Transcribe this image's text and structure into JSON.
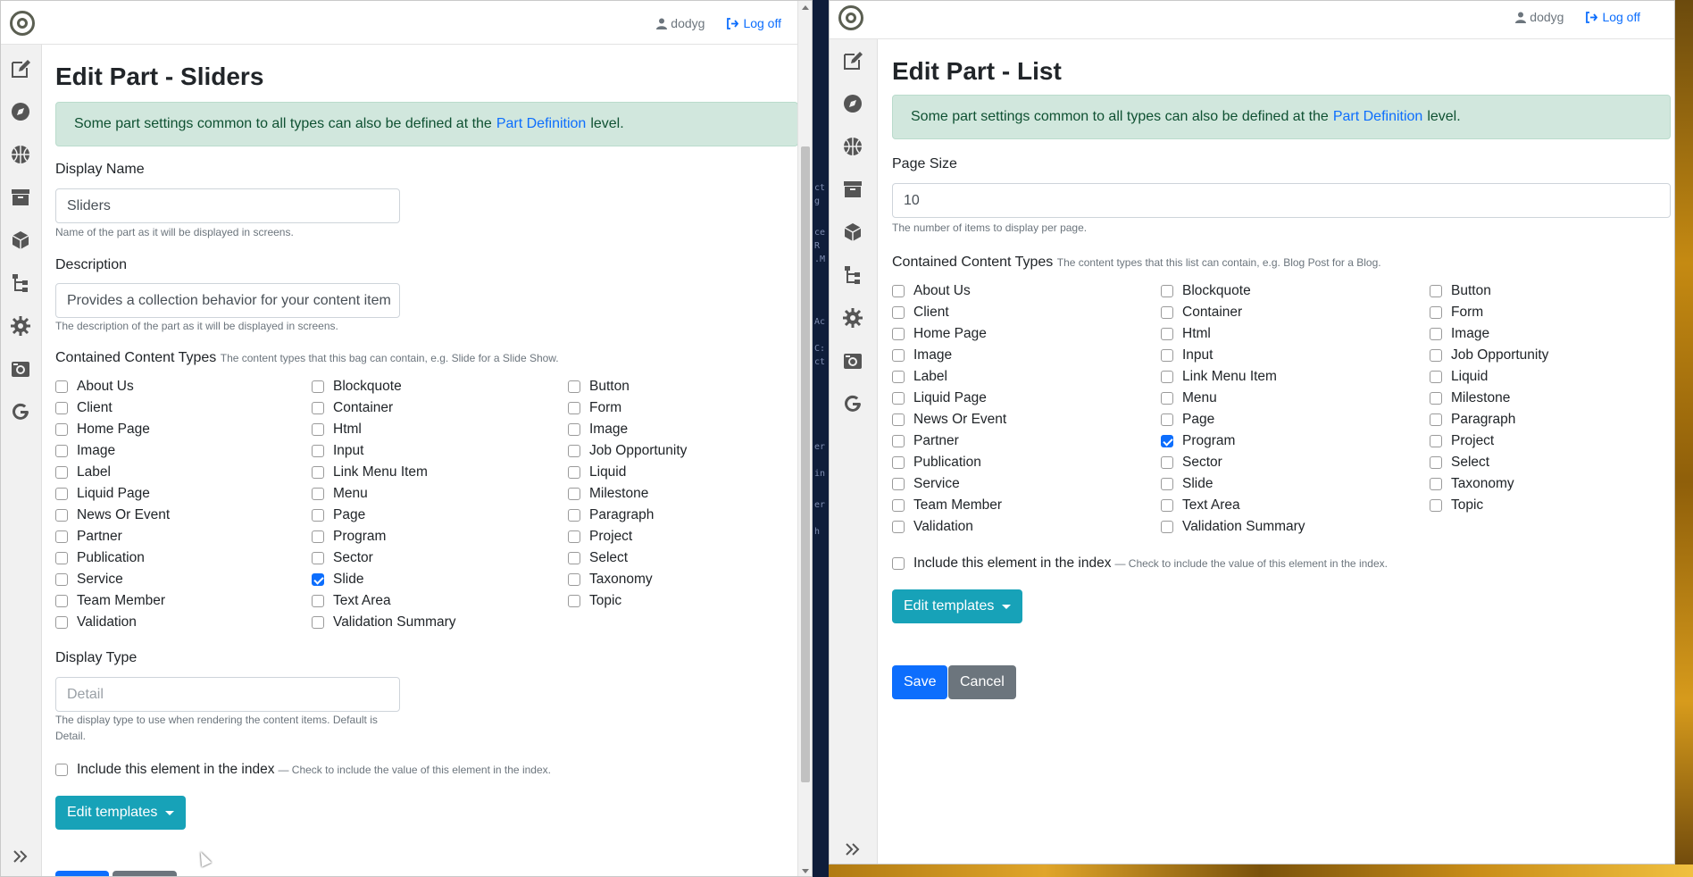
{
  "left_window": {
    "user": "dodyg",
    "logoff": "Log off",
    "title": "Edit Part - Sliders",
    "alert": {
      "prefix": "Some part settings common to all types can also be defined at the",
      "link": "Part Definition",
      "suffix": "level."
    },
    "display_name": {
      "label": "Display Name",
      "value": "Sliders",
      "hint": "Name of the part as it will be displayed in screens."
    },
    "description": {
      "label": "Description",
      "value": "Provides a collection behavior for your content item",
      "hint": "The description of the part as it will be displayed in screens."
    },
    "contained": {
      "label": "Contained Content Types",
      "hint": "The content types that this bag can contain, e.g. Slide for a Slide Show."
    },
    "col1": [
      {
        "label": "About Us",
        "checked": false
      },
      {
        "label": "Client",
        "checked": false
      },
      {
        "label": "Home Page",
        "checked": false
      },
      {
        "label": "Image",
        "checked": false
      },
      {
        "label": "Label",
        "checked": false
      },
      {
        "label": "Liquid Page",
        "checked": false
      },
      {
        "label": "News Or Event",
        "checked": false
      },
      {
        "label": "Partner",
        "checked": false
      },
      {
        "label": "Publication",
        "checked": false
      },
      {
        "label": "Service",
        "checked": false
      },
      {
        "label": "Team Member",
        "checked": false
      },
      {
        "label": "Validation",
        "checked": false
      }
    ],
    "col2": [
      {
        "label": "Blockquote",
        "checked": false
      },
      {
        "label": "Container",
        "checked": false
      },
      {
        "label": "Html",
        "checked": false
      },
      {
        "label": "Input",
        "checked": false
      },
      {
        "label": "Link Menu Item",
        "checked": false
      },
      {
        "label": "Menu",
        "checked": false
      },
      {
        "label": "Page",
        "checked": false
      },
      {
        "label": "Program",
        "checked": false
      },
      {
        "label": "Sector",
        "checked": false
      },
      {
        "label": "Slide",
        "checked": true
      },
      {
        "label": "Text Area",
        "checked": false
      },
      {
        "label": "Validation Summary",
        "checked": false
      }
    ],
    "col3": [
      {
        "label": "Button",
        "checked": false
      },
      {
        "label": "Form",
        "checked": false
      },
      {
        "label": "Image",
        "checked": false
      },
      {
        "label": "Job Opportunity",
        "checked": false
      },
      {
        "label": "Liquid",
        "checked": false
      },
      {
        "label": "Milestone",
        "checked": false
      },
      {
        "label": "Paragraph",
        "checked": false
      },
      {
        "label": "Project",
        "checked": false
      },
      {
        "label": "Select",
        "checked": false
      },
      {
        "label": "Taxonomy",
        "checked": false
      },
      {
        "label": "Topic",
        "checked": false
      }
    ],
    "display_type": {
      "label": "Display Type",
      "placeholder": "Detail",
      "hint": "The display type to use when rendering the content items. Default is Detail."
    },
    "index": {
      "label": "Include this element in the index",
      "hint": "— Check to include the value of this element in the index."
    },
    "edit_templates": "Edit templates"
  },
  "right_window": {
    "user": "dodyg",
    "logoff": "Log off",
    "title": "Edit Part - List",
    "alert": {
      "prefix": "Some part settings common to all types can also be defined at the",
      "link": "Part Definition",
      "suffix": "level."
    },
    "page_size": {
      "label": "Page Size",
      "value": "10",
      "hint": "The number of items to display per page."
    },
    "contained": {
      "label": "Contained Content Types",
      "hint": "The content types that this list can contain, e.g. Blog Post for a Blog."
    },
    "col1": [
      {
        "label": "About Us",
        "checked": false
      },
      {
        "label": "Client",
        "checked": false
      },
      {
        "label": "Home Page",
        "checked": false
      },
      {
        "label": "Image",
        "checked": false
      },
      {
        "label": "Label",
        "checked": false
      },
      {
        "label": "Liquid Page",
        "checked": false
      },
      {
        "label": "News Or Event",
        "checked": false
      },
      {
        "label": "Partner",
        "checked": false
      },
      {
        "label": "Publication",
        "checked": false
      },
      {
        "label": "Service",
        "checked": false
      },
      {
        "label": "Team Member",
        "checked": false
      },
      {
        "label": "Validation",
        "checked": false
      }
    ],
    "col2": [
      {
        "label": "Blockquote",
        "checked": false
      },
      {
        "label": "Container",
        "checked": false
      },
      {
        "label": "Html",
        "checked": false
      },
      {
        "label": "Input",
        "checked": false
      },
      {
        "label": "Link Menu Item",
        "checked": false
      },
      {
        "label": "Menu",
        "checked": false
      },
      {
        "label": "Page",
        "checked": false
      },
      {
        "label": "Program",
        "checked": true
      },
      {
        "label": "Sector",
        "checked": false
      },
      {
        "label": "Slide",
        "checked": false
      },
      {
        "label": "Text Area",
        "checked": false
      },
      {
        "label": "Validation Summary",
        "checked": false
      }
    ],
    "col3": [
      {
        "label": "Button",
        "checked": false
      },
      {
        "label": "Form",
        "checked": false
      },
      {
        "label": "Image",
        "checked": false
      },
      {
        "label": "Job Opportunity",
        "checked": false
      },
      {
        "label": "Liquid",
        "checked": false
      },
      {
        "label": "Milestone",
        "checked": false
      },
      {
        "label": "Paragraph",
        "checked": false
      },
      {
        "label": "Project",
        "checked": false
      },
      {
        "label": "Select",
        "checked": false
      },
      {
        "label": "Taxonomy",
        "checked": false
      },
      {
        "label": "Topic",
        "checked": false
      }
    ],
    "index": {
      "label": "Include this element in the index",
      "hint": "— Check to include the value of this element in the index."
    },
    "edit_templates": "Edit templates",
    "save": "Save",
    "cancel": "Cancel"
  },
  "sidebar_icons": [
    "edit-icon",
    "compass-icon",
    "basketball-icon",
    "archive-icon",
    "cube-icon",
    "sitemap-icon",
    "cog-icon",
    "camera-icon",
    "google-icon"
  ],
  "colors": {
    "primary": "#0d6efd",
    "info": "#17a2b8",
    "alert_bg": "#d1e7dd",
    "secondary": "#6c757d"
  }
}
